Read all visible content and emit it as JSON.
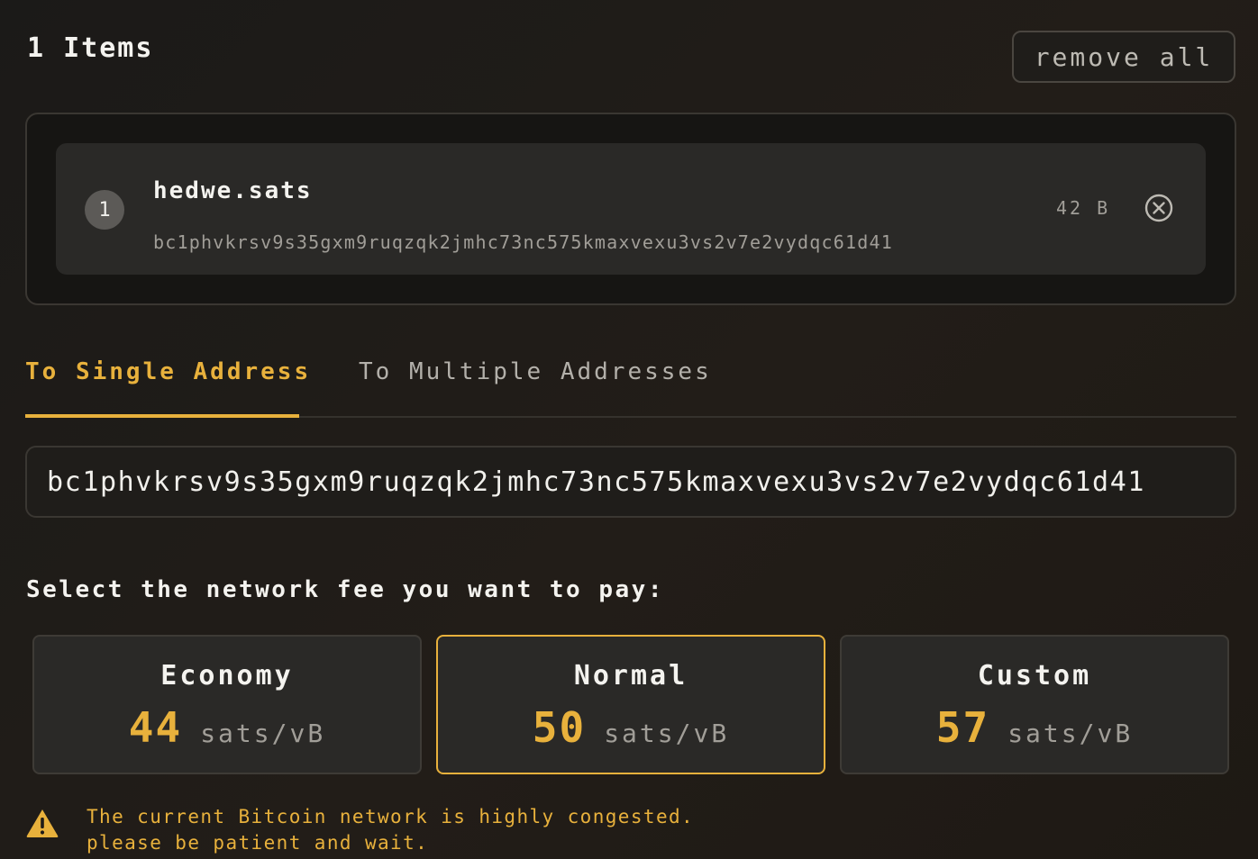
{
  "header": {
    "items_count_label": "1 Items",
    "remove_all_label": "remove all"
  },
  "items": [
    {
      "index": "1",
      "name": "hedwe.sats",
      "address": "bc1phvkrsv9s35gxm9ruqzqk2jmhc73nc575kmaxvexu3vs2v7e2vydqc61d41",
      "size": "42 B",
      "remove_icon": "close-circle-icon"
    }
  ],
  "tabs": [
    {
      "label": "To Single Address",
      "active": true
    },
    {
      "label": "To Multiple Addresses",
      "active": false
    }
  ],
  "recipient": {
    "value": "bc1phvkrsv9s35gxm9ruqzqk2jmhc73nc575kmaxvexu3vs2v7e2vydqc61d41"
  },
  "fee": {
    "prompt": "Select the network fee you want to pay:",
    "options": [
      {
        "name": "Economy",
        "value": "44",
        "unit": "sats/vB",
        "selected": false
      },
      {
        "name": "Normal",
        "value": "50",
        "unit": "sats/vB",
        "selected": true
      },
      {
        "name": "Custom",
        "value": "57",
        "unit": "sats/vB",
        "selected": false
      }
    ]
  },
  "warning": {
    "icon": "warning-triangle-icon",
    "line1": "The current Bitcoin network is highly congested.",
    "line2": "please be patient and wait."
  },
  "colors": {
    "accent": "#e8b13c",
    "background": "#1e1b18",
    "card": "#2a2927"
  }
}
